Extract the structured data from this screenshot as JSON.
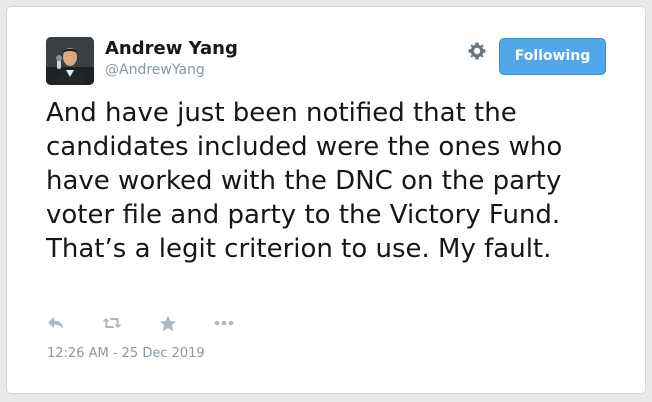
{
  "tweet": {
    "author": {
      "name": "Andrew Yang",
      "handle": "@AndrewYang",
      "avatar_icon": "profile-photo"
    },
    "follow_button_label": "Following",
    "settings_icon": "gear-icon",
    "text": "And have just been notified that the candidates included were the ones who have worked with the DNC on the party voter file and party to the Victory Fund. That’s a legit criterion to use. My fault.",
    "actions": [
      {
        "icon": "reply-icon"
      },
      {
        "icon": "retweet-icon"
      },
      {
        "icon": "like-star-icon"
      },
      {
        "icon": "more-icon"
      }
    ],
    "timestamp": "12:26 AM - 25 Dec 2019"
  },
  "colors": {
    "accent": "#50a8ea",
    "text": "#14171a",
    "muted": "#8899a6",
    "icon": "#aab8c2",
    "background": "#e8e9ea"
  }
}
